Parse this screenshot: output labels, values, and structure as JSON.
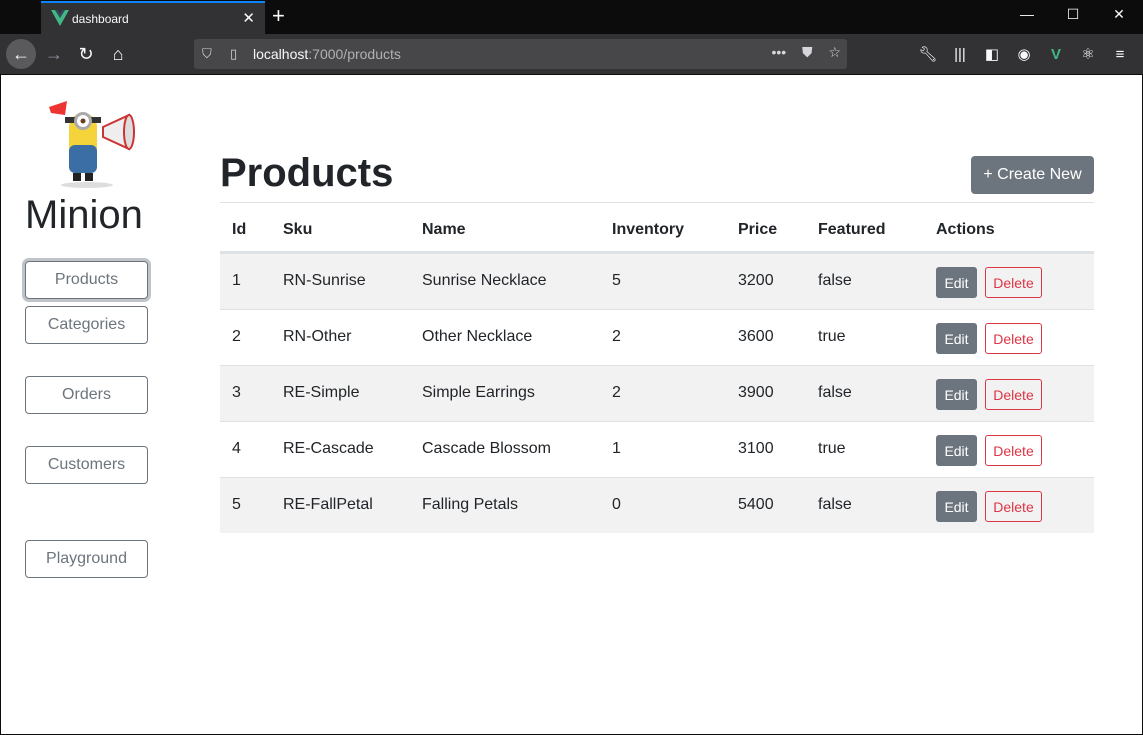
{
  "browser": {
    "tab_title": "dashboard",
    "url_host": "localhost",
    "url_rest": ":7000/products",
    "new_tab": "+",
    "tab_close": "✕"
  },
  "sidebar": {
    "brand": "Minion",
    "items": [
      {
        "label": "Products"
      },
      {
        "label": "Categories"
      },
      {
        "label": "Orders"
      },
      {
        "label": "Customers"
      },
      {
        "label": "Playground"
      }
    ]
  },
  "main": {
    "title": "Products",
    "create_label": "+ Create New",
    "columns": [
      "Id",
      "Sku",
      "Name",
      "Inventory",
      "Price",
      "Featured",
      "Actions"
    ],
    "rows": [
      {
        "id": "1",
        "sku": "RN-Sunrise",
        "name": "Sunrise Necklace",
        "inventory": "5",
        "price": "3200",
        "featured": "false"
      },
      {
        "id": "2",
        "sku": "RN-Other",
        "name": "Other Necklace",
        "inventory": "2",
        "price": "3600",
        "featured": "true"
      },
      {
        "id": "3",
        "sku": "RE-Simple",
        "name": "Simple Earrings",
        "inventory": "2",
        "price": "3900",
        "featured": "false"
      },
      {
        "id": "4",
        "sku": "RE-Cascade",
        "name": "Cascade Blossom",
        "inventory": "1",
        "price": "3100",
        "featured": "true"
      },
      {
        "id": "5",
        "sku": "RE-FallPetal",
        "name": "Falling Petals",
        "inventory": "0",
        "price": "5400",
        "featured": "false"
      }
    ],
    "edit_label": "Edit",
    "delete_label": "Delete"
  },
  "colors": {
    "secondary": "#6c757d",
    "danger": "#dc3545",
    "vue_green": "#41b883",
    "accent": "#0a84ff"
  },
  "icons": [
    "vue-icon",
    "close-icon",
    "back-icon",
    "forward-icon",
    "reload-icon",
    "home-icon",
    "shield-icon",
    "page-icon",
    "more-icon",
    "pocket-icon",
    "star-icon",
    "wrench-icon",
    "library-icon",
    "sidebar-icon",
    "account-icon",
    "react-icon",
    "menu-icon",
    "minion-logo"
  ]
}
